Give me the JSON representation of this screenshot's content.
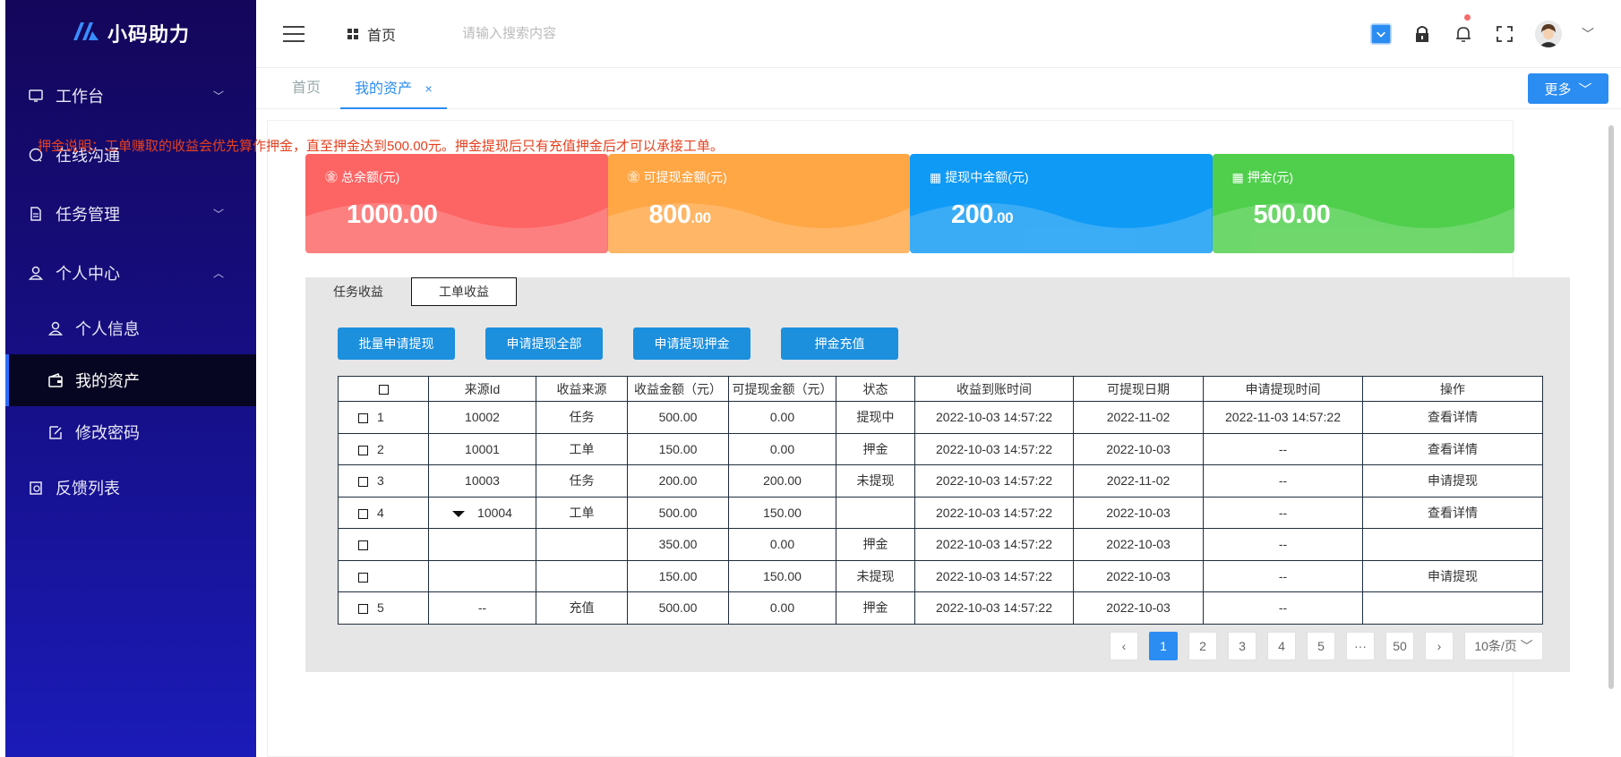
{
  "sidebar": {
    "logo_mark": "/\\",
    "logo_text": "小码助力",
    "items": [
      {
        "label": "工作台",
        "icon": "monitor-icon",
        "chevron": "down"
      },
      {
        "label": "在线沟通",
        "icon": "chat-icon"
      },
      {
        "label": "任务管理",
        "icon": "document-icon",
        "chevron": "down"
      },
      {
        "label": "个人中心",
        "icon": "user-icon",
        "chevron": "up"
      },
      {
        "label": "个人信息",
        "icon": "user-icon",
        "sub": true
      },
      {
        "label": "我的资产",
        "icon": "wallet-icon",
        "sub": true,
        "active": true
      },
      {
        "label": "修改密码",
        "icon": "edit-icon",
        "sub": true
      },
      {
        "label": "反馈列表",
        "icon": "feedback-icon"
      }
    ]
  },
  "header": {
    "home_label": "首页",
    "search_placeholder": "请输入搜索内容"
  },
  "tabs": {
    "home": "首页",
    "current": "我的资产",
    "close": "×",
    "more": "更多"
  },
  "notice": "押金说明：工单赚取的收益会优先算作押金，直至押金达到500.00元。押金提现后只有充值押金后才可以承接工单。",
  "cards": [
    {
      "title": "总余额(元)",
      "int": "1000.00",
      "dec": "",
      "color": "#fd6464"
    },
    {
      "title": "可提现金额(元)",
      "int": "800",
      "dec": ".00",
      "color": "#ffa645"
    },
    {
      "title": "提现中金额(元)",
      "int": "200",
      "dec": ".00",
      "color": "#0f9af5"
    },
    {
      "title": "押金(元)",
      "int": "500.00",
      "dec": "",
      "color": "#4fcf4c"
    }
  ],
  "section": {
    "tab_active": "任务收益",
    "tab_other": "工单收益",
    "buttons": [
      "批量申请提现",
      "申请提现全部",
      "申请提现押金",
      "押金充值"
    ]
  },
  "table": {
    "headers": [
      "来源Id",
      "收益来源",
      "收益金额（元）",
      "可提现金额（元）",
      "状态",
      "收益到账时间",
      "可提现日期",
      "申请提现时间",
      "操作"
    ],
    "rows": [
      {
        "num": "1",
        "id": "10002",
        "source": "任务",
        "amount": "500.00",
        "withdrawable": "0.00",
        "status": "提现中",
        "time": "2022-10-03 14:57:22",
        "date": "2022-11-02",
        "apply": "2022-11-03 14:57:22",
        "op": "查看详情"
      },
      {
        "num": "2",
        "id": "10001",
        "source": "工单",
        "amount": "150.00",
        "withdrawable": "0.00",
        "status": "押金",
        "time": "2022-10-03 14:57:22",
        "date": "2022-10-03",
        "apply": "--",
        "op": "查看详情"
      },
      {
        "num": "3",
        "id": "10003",
        "source": "任务",
        "amount": "200.00",
        "withdrawable": "200.00",
        "status": "未提现",
        "time": "2022-10-03 14:57:22",
        "date": "2022-11-02",
        "apply": "--",
        "op": "申请提现"
      },
      {
        "num": "4",
        "id": "10004",
        "source": "工单",
        "amount": "500.00",
        "withdrawable": "150.00",
        "status": "",
        "time": "2022-10-03 14:57:22",
        "date": "2022-10-03",
        "apply": "--",
        "op": "查看详情",
        "expanded": true
      },
      {
        "num": "",
        "id": "",
        "source": "",
        "amount": "350.00",
        "withdrawable": "0.00",
        "status": "押金",
        "time": "2022-10-03 14:57:22",
        "date": "2022-10-03",
        "apply": "--",
        "op": ""
      },
      {
        "num": "",
        "id": "",
        "source": "",
        "amount": "150.00",
        "withdrawable": "150.00",
        "status": "未提现",
        "time": "2022-10-03 14:57:22",
        "date": "2022-10-03",
        "apply": "--",
        "op": "申请提现"
      },
      {
        "num": "5",
        "id": "--",
        "source": "充值",
        "amount": "500.00",
        "withdrawable": "0.00",
        "status": "押金",
        "time": "2022-10-03 14:57:22",
        "date": "2022-10-03",
        "apply": "--",
        "op": ""
      }
    ]
  },
  "pager": {
    "prev": "‹",
    "pages": [
      "1",
      "2",
      "3",
      "4",
      "5",
      "···",
      "50"
    ],
    "next": "›",
    "size": "10条/页"
  }
}
